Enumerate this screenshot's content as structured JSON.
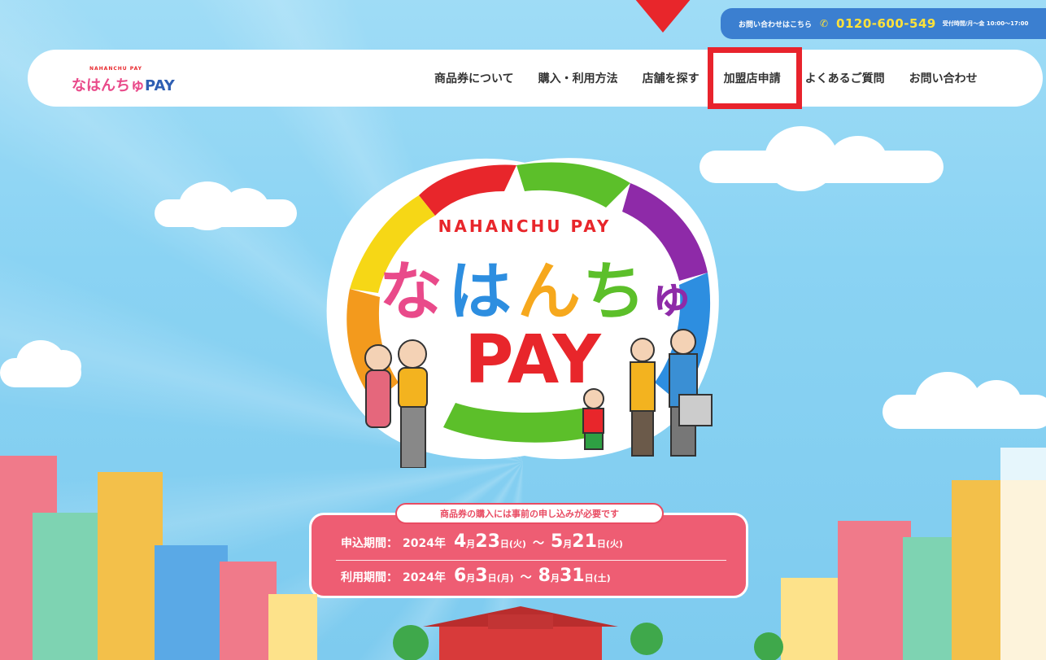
{
  "contact": {
    "label": "お問い合わせはこちら",
    "phone": "0120-600-549",
    "hours": "受付時間/月〜金 10:00〜17:00"
  },
  "header": {
    "logo_small": "NAHANCHU PAY",
    "logo_main": "なはんちゅPAY",
    "nav": [
      {
        "label": "商品券について"
      },
      {
        "label": "購入・利用方法"
      },
      {
        "label": "店舗を探す"
      },
      {
        "label": "加盟店申請"
      },
      {
        "label": "よくあるご質問"
      },
      {
        "label": "お問い合わせ"
      }
    ]
  },
  "hero": {
    "subtitle": "NAHANCHU PAY",
    "title_chars": [
      "な",
      "は",
      "ん",
      "ち",
      "ゅ"
    ],
    "title_pay": "PAY"
  },
  "notice": {
    "pill": "商品券の購入には事前の申し込みが必要です",
    "apply": {
      "label": "申込期間：",
      "year": "2024年",
      "m1": "4",
      "d1": "23",
      "w1": "(火)",
      "sep": "〜",
      "m2": "5",
      "d2": "21",
      "w2": "(火)"
    },
    "use": {
      "label": "利用期間：",
      "year": "2024年",
      "m1": "6",
      "d1": "3",
      "w1": "(月)",
      "sep": "〜",
      "m2": "8",
      "d2": "31",
      "w2": "(土)"
    },
    "month_unit": "月",
    "day_unit": "日"
  },
  "colors": {
    "accent_red": "#e8262b",
    "contact_blue": "#3b7fd0",
    "tel_yellow": "#ffe23a",
    "notice_pink": "#ee5d73"
  },
  "icons": {
    "phone": "phone-icon",
    "arrow": "down-arrow-icon"
  }
}
